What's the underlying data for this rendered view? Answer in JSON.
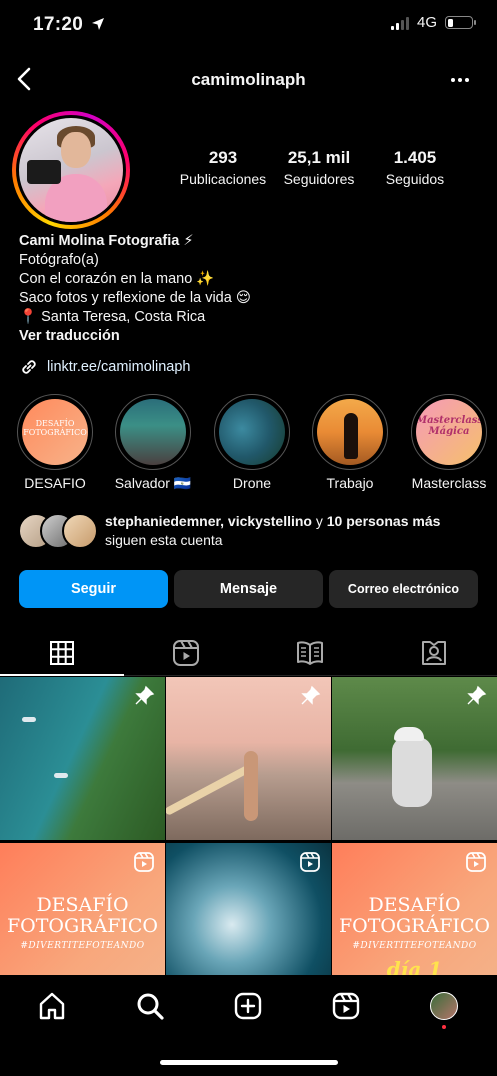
{
  "status_bar": {
    "time": "17:20",
    "network": "4G"
  },
  "header": {
    "username": "camimolinaph"
  },
  "stats": [
    {
      "value": "293",
      "label": "Publicaciones"
    },
    {
      "value": "25,1 mil",
      "label": "Seguidores"
    },
    {
      "value": "1.405",
      "label": "Seguidos"
    }
  ],
  "bio": {
    "name": "Cami Molina Fotografia ⚡",
    "category": "Fotógrafo(a)",
    "line1": "Con el corazón en la mano ✨",
    "line2": "Saco fotos y reflexione de la vida 😌",
    "location": "📍 Santa Teresa, Costa Rica",
    "translate": "Ver traducción",
    "link": "linktr.ee/camimolinaph"
  },
  "highlights": [
    {
      "label": "DESAFIO",
      "cover_text": "DESAFÍO FOTOGRÁFICO"
    },
    {
      "label": "Salvador 🇸🇻"
    },
    {
      "label": "Drone"
    },
    {
      "label": "Trabajo"
    },
    {
      "label": "Masterclass",
      "cover_text": "Masterclass Mágica"
    }
  ],
  "followed_by": {
    "names": "stephaniedemner, vickystellino",
    "connector": " y ",
    "others": "10 personas más",
    "suffix": "siguen esta cuenta"
  },
  "buttons": {
    "follow": "Seguir",
    "message": "Mensaje",
    "email": "Correo electrónico"
  },
  "grid": {
    "post4": {
      "title": "DESAFÍO FOTOGRÁFICO",
      "hashtag": "#DIVERTITEFOTEANDO"
    },
    "post6": {
      "title": "DESAFÍO FOTOGRÁFICO",
      "hashtag": "#DIVERTITEFOTEANDO",
      "day": "día 1"
    }
  },
  "colors": {
    "accent": "#0095f6",
    "button_dark": "#262626",
    "background": "#000000"
  },
  "icons": {
    "tabs": [
      "grid-icon",
      "reels-icon",
      "guides-icon",
      "tagged-icon"
    ],
    "nav": [
      "home-icon",
      "search-icon",
      "create-icon",
      "reels-icon",
      "profile-avatar"
    ]
  }
}
